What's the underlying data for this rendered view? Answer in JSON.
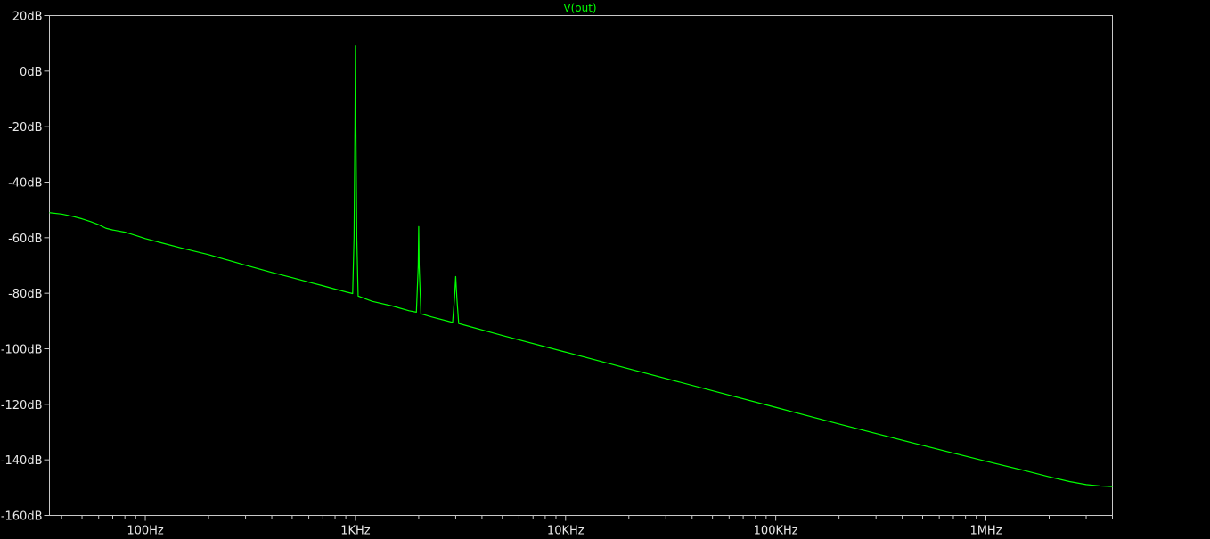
{
  "chart_data": {
    "type": "line",
    "title": "V(out)",
    "xlabel": "",
    "ylabel": "",
    "x_scale": "log",
    "xlim": [
      35,
      4000000
    ],
    "ylim": [
      -160,
      20
    ],
    "y_ticks": [
      20,
      0,
      -20,
      -40,
      -60,
      -80,
      -100,
      -120,
      -140,
      -160
    ],
    "y_tick_labels": [
      "20dB",
      "0dB",
      "-20dB",
      "-40dB",
      "-60dB",
      "-80dB",
      "-100dB",
      "-120dB",
      "-140dB",
      "-160dB"
    ],
    "x_ticks": [
      100,
      1000,
      10000,
      100000,
      1000000
    ],
    "x_tick_labels": [
      "100Hz",
      "1KHz",
      "10KHz",
      "100KHz",
      "1MHz"
    ],
    "grid": false,
    "series": [
      {
        "name": "V(out)",
        "color": "#00ff00",
        "x": [
          35,
          40,
          45,
          50,
          55,
          60,
          65,
          70,
          80,
          90,
          100,
          120,
          150,
          200,
          300,
          400,
          500,
          600,
          700,
          800,
          900,
          970,
          985,
          995,
          1000,
          1005,
          1015,
          1030,
          1200,
          1500,
          1800,
          1950,
          1990,
          2000,
          2010,
          2050,
          2300,
          2900,
          2960,
          3000,
          3040,
          3100,
          5000,
          10000,
          20000,
          50000,
          100000,
          200000,
          500000,
          1000000,
          1500000,
          2000000,
          2500000,
          3000000,
          3500000,
          4000000
        ],
        "y": [
          -51,
          -51.5,
          -52.3,
          -53.2,
          -54.2,
          -55.3,
          -56.6,
          -57.2,
          -58,
          -59.2,
          -60.3,
          -61.9,
          -63.8,
          -66.1,
          -69.9,
          -72.5,
          -74.4,
          -76.0,
          -77.3,
          -78.5,
          -79.5,
          -80.1,
          -60,
          -20,
          9,
          -20,
          -60,
          -81,
          -82.9,
          -84.6,
          -86.3,
          -86.8,
          -70,
          -56,
          -70,
          -87.4,
          -88.5,
          -90.5,
          -82,
          -74,
          -82,
          -90.9,
          -95.2,
          -101.2,
          -107.2,
          -115.1,
          -121.1,
          -127.1,
          -134.8,
          -140.5,
          -143.7,
          -146.1,
          -147.8,
          -148.9,
          -149.4,
          -149.6
        ]
      }
    ]
  }
}
